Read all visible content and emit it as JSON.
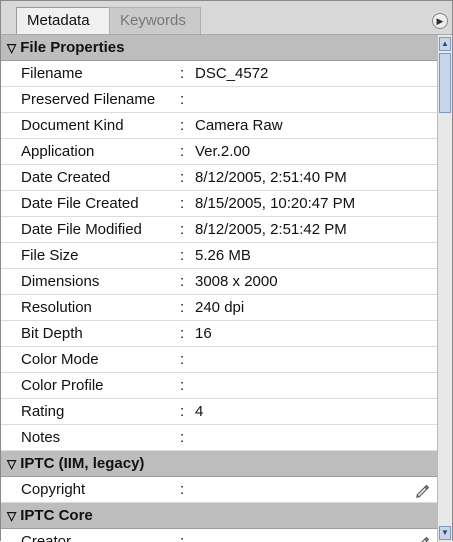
{
  "tabs": [
    {
      "label": "Metadata"
    },
    {
      "label": "Keywords"
    }
  ],
  "sections": {
    "file_properties": {
      "title": "File Properties",
      "rows": [
        {
          "label": "Filename",
          "value": "DSC_4572"
        },
        {
          "label": "Preserved Filename",
          "value": ""
        },
        {
          "label": "Document Kind",
          "value": "Camera Raw"
        },
        {
          "label": "Application",
          "value": "Ver.2.00"
        },
        {
          "label": "Date Created",
          "value": "8/12/2005, 2:51:40 PM"
        },
        {
          "label": "Date File Created",
          "value": "8/15/2005, 10:20:47 PM"
        },
        {
          "label": "Date File Modified",
          "value": "8/12/2005, 2:51:42 PM"
        },
        {
          "label": "File Size",
          "value": "5.26 MB"
        },
        {
          "label": "Dimensions",
          "value": "3008 x 2000"
        },
        {
          "label": "Resolution",
          "value": "240 dpi"
        },
        {
          "label": "Bit Depth",
          "value": "16"
        },
        {
          "label": "Color Mode",
          "value": ""
        },
        {
          "label": "Color Profile",
          "value": ""
        },
        {
          "label": "Rating",
          "value": "4"
        },
        {
          "label": "Notes",
          "value": ""
        }
      ]
    },
    "iptc_legacy": {
      "title": "IPTC (IIM, legacy)",
      "rows": [
        {
          "label": "Copyright",
          "value": "",
          "editable_icon": "pencil-icon"
        }
      ]
    },
    "iptc_core": {
      "title": "IPTC Core",
      "rows": [
        {
          "label": "Creator",
          "value": "",
          "editable_icon": "pencil-icon"
        }
      ]
    }
  },
  "colon": ":",
  "icons": {
    "section_toggle": "triangle-down-icon",
    "panel_menu": "flyout-menu-icon",
    "scroll_up": "scroll-up-icon",
    "scroll_down": "scroll-down-icon"
  }
}
